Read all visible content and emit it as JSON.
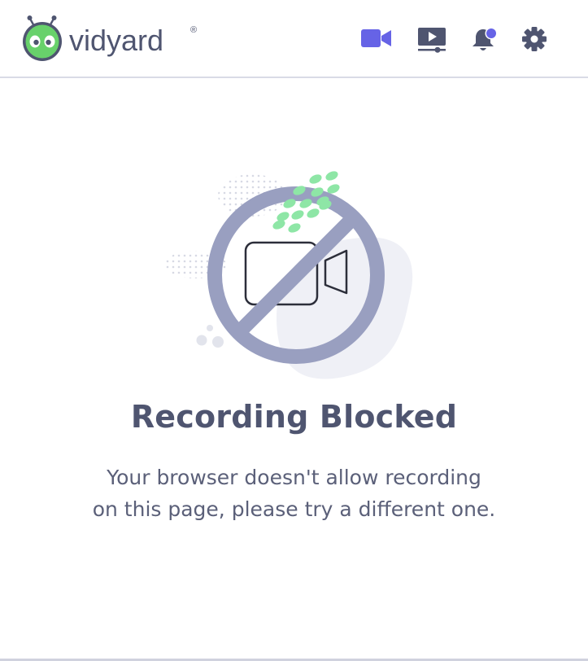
{
  "brand": {
    "name": "vidyard",
    "trademark": "®",
    "color": "#68d16b"
  },
  "nav": {
    "icons": [
      {
        "name": "video-camera-icon",
        "active": true,
        "color": "#6663e6"
      },
      {
        "name": "video-library-icon",
        "active": false,
        "color": "#4f5570"
      },
      {
        "name": "notifications-bell-icon",
        "active": false,
        "color": "#4f5570",
        "badge_color": "#6663e6"
      },
      {
        "name": "settings-gear-icon",
        "active": false,
        "color": "#4f5570"
      }
    ]
  },
  "main": {
    "title": "Recording Blocked",
    "message_line1": "Your browser doesn't allow recording",
    "message_line2": "on this page, please try a different one.",
    "illustration": "recording-blocked-icon",
    "colors": {
      "blocked_ring": "#999fc0",
      "title": "#4f5570",
      "text": "#5b6079",
      "accent_green": "#8ee6a6"
    }
  }
}
